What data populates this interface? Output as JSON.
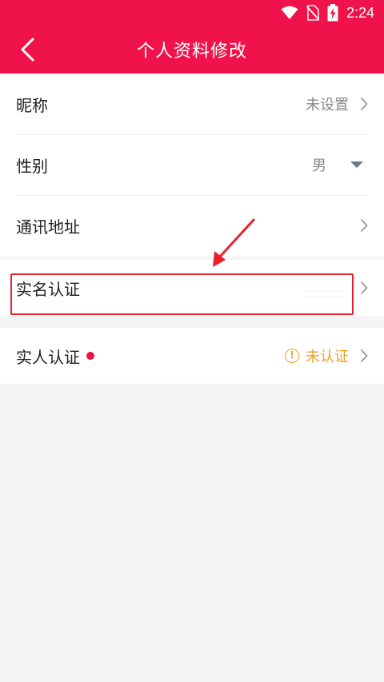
{
  "status_bar": {
    "time": "2:24"
  },
  "header": {
    "title": "个人资料修改",
    "back_icon": "chevron-left-icon"
  },
  "profile": {
    "nickname": {
      "label": "昵称",
      "value": "未设置"
    },
    "gender": {
      "label": "性别",
      "value": "男"
    },
    "address": {
      "label": "通讯地址"
    }
  },
  "real_name": {
    "label": "实名认证"
  },
  "real_person": {
    "label": "实人认证",
    "status": "未认证",
    "status_icon": "warning-circle-icon"
  },
  "colors": {
    "brand": "#f0124a",
    "warning": "#f0a21d",
    "annotation": "#e8212e"
  }
}
